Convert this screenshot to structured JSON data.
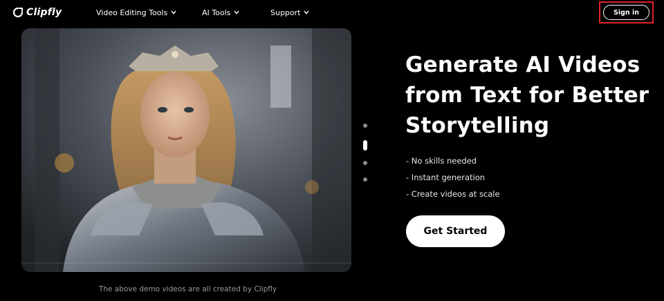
{
  "header": {
    "brand": "Clipfly",
    "nav": [
      {
        "label": "Video Editing Tools"
      },
      {
        "label": "AI Tools"
      },
      {
        "label": "Support"
      }
    ],
    "sign_in_label": "Sign in"
  },
  "hero": {
    "headline": "Generate AI Videos from Text for Better Storytelling",
    "bullets": [
      "- No skills needed",
      "- Instant generation",
      "- Create videos at scale"
    ],
    "cta_label": "Get Started"
  },
  "demo": {
    "caption": "The above demo videos are all created by Clipfly",
    "slides_count": 4,
    "active_slide": 2
  },
  "colors": {
    "background": "#000000",
    "highlight_outline": "#e0242b",
    "text": "#ffffff",
    "caption": "#9a9a9a"
  }
}
